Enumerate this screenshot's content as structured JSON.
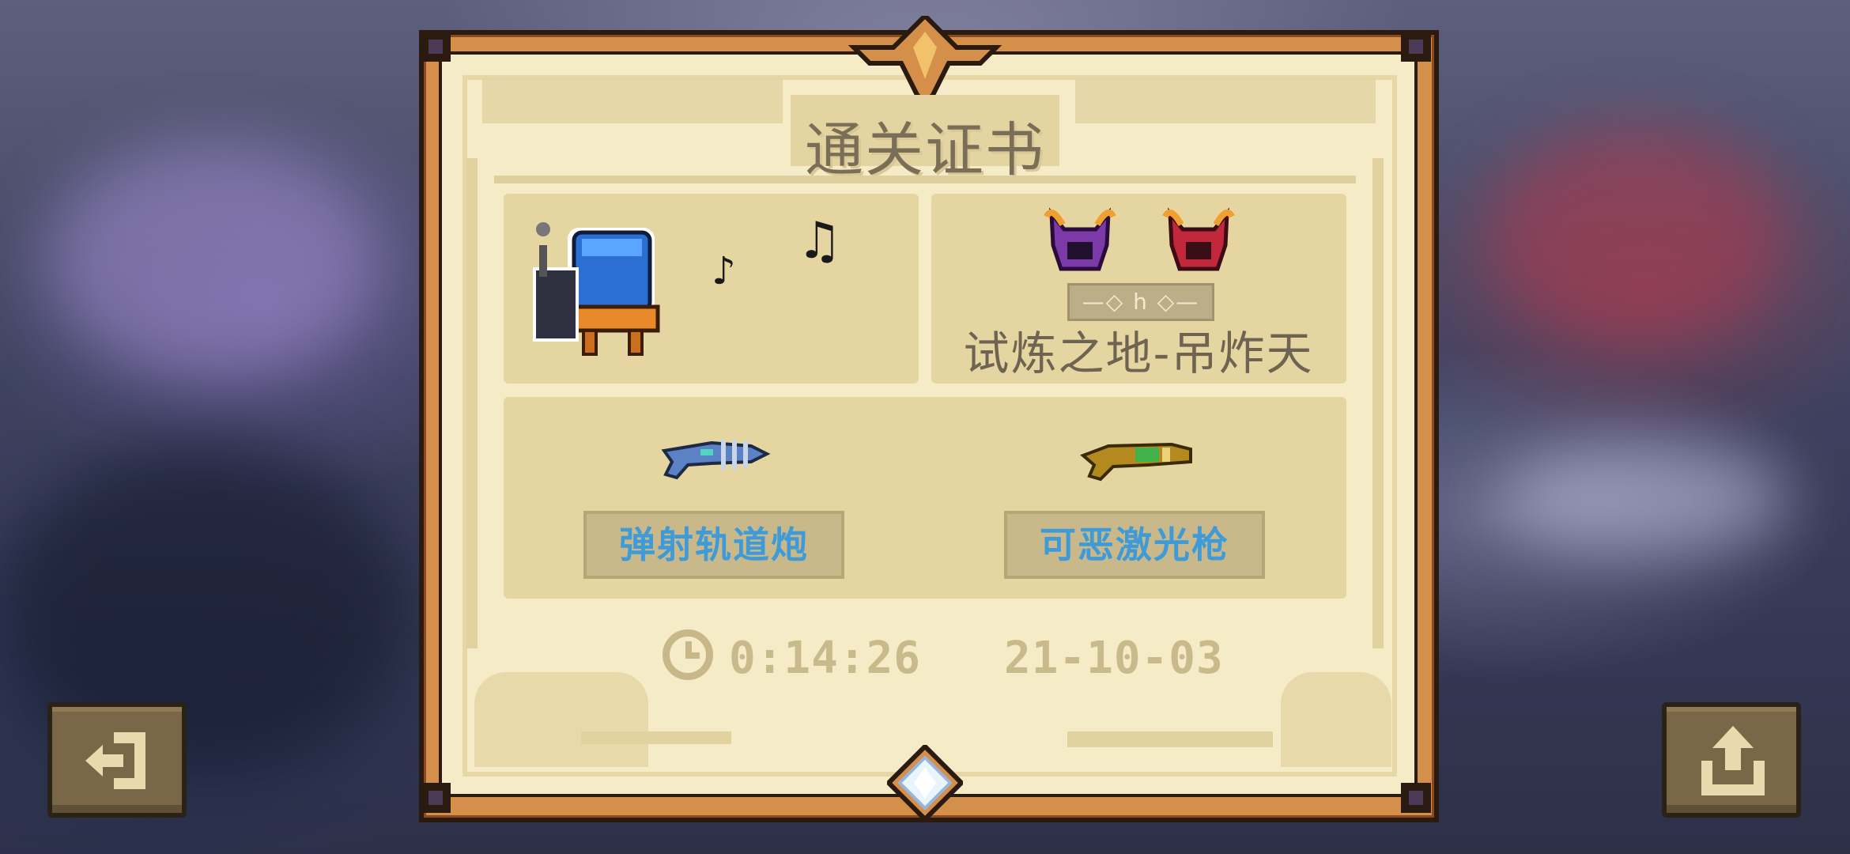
{
  "certificate": {
    "title": "通关证书",
    "badge_text": "—◇ h ◇—",
    "stage_name": "试炼之地-吊炸天",
    "character_icon": "robot-character-icon",
    "boss_icons": [
      "purple-demon-icon",
      "red-demon-icon"
    ],
    "weapons": [
      {
        "name": "弹射轨道炮",
        "icon": "railgun-icon"
      },
      {
        "name": "可恶激光枪",
        "icon": "laser-gun-icon"
      }
    ],
    "time": "0:14:26",
    "date": "21-10-03",
    "colors": {
      "weapon_label_text": "#3f9ad8",
      "paper": "#f6ebc7",
      "frame": "#d4904a"
    }
  },
  "buttons": {
    "exit_icon": "exit-icon",
    "share_icon": "share-icon"
  }
}
